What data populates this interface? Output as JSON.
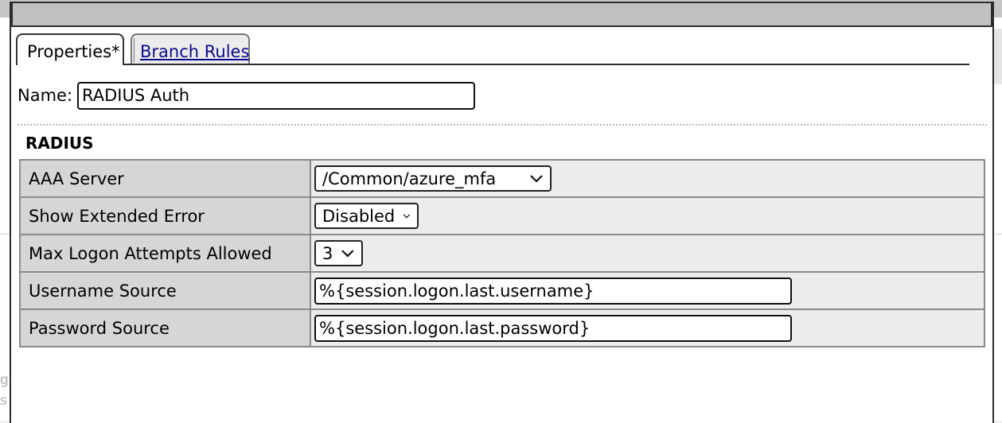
{
  "tabs": [
    {
      "label": "Properties*",
      "active": true
    },
    {
      "label": "Branch Rules",
      "active": false
    }
  ],
  "name": {
    "label": "Name:",
    "value": "RADIUS Auth"
  },
  "section": {
    "title": "RADIUS"
  },
  "properties": {
    "aaa_server": {
      "label": "AAA Server",
      "value": "/Common/azure_mfa"
    },
    "show_extended_error": {
      "label": "Show Extended Error",
      "value": "Disabled"
    },
    "max_logon_attempts": {
      "label": "Max Logon Attempts Allowed",
      "value": "3"
    },
    "username_source": {
      "label": "Username Source",
      "value": "%{session.logon.last.username}"
    },
    "password_source": {
      "label": "Password Source",
      "value": "%{session.logon.last.password}"
    }
  },
  "background": {
    "fragment_1": "g",
    "fragment_2": "s"
  },
  "colors": {
    "titlebar": "#c0c0c0",
    "label_cell": "#d6d6d6",
    "value_cell": "#ececec",
    "link": "#0a0a8c"
  }
}
